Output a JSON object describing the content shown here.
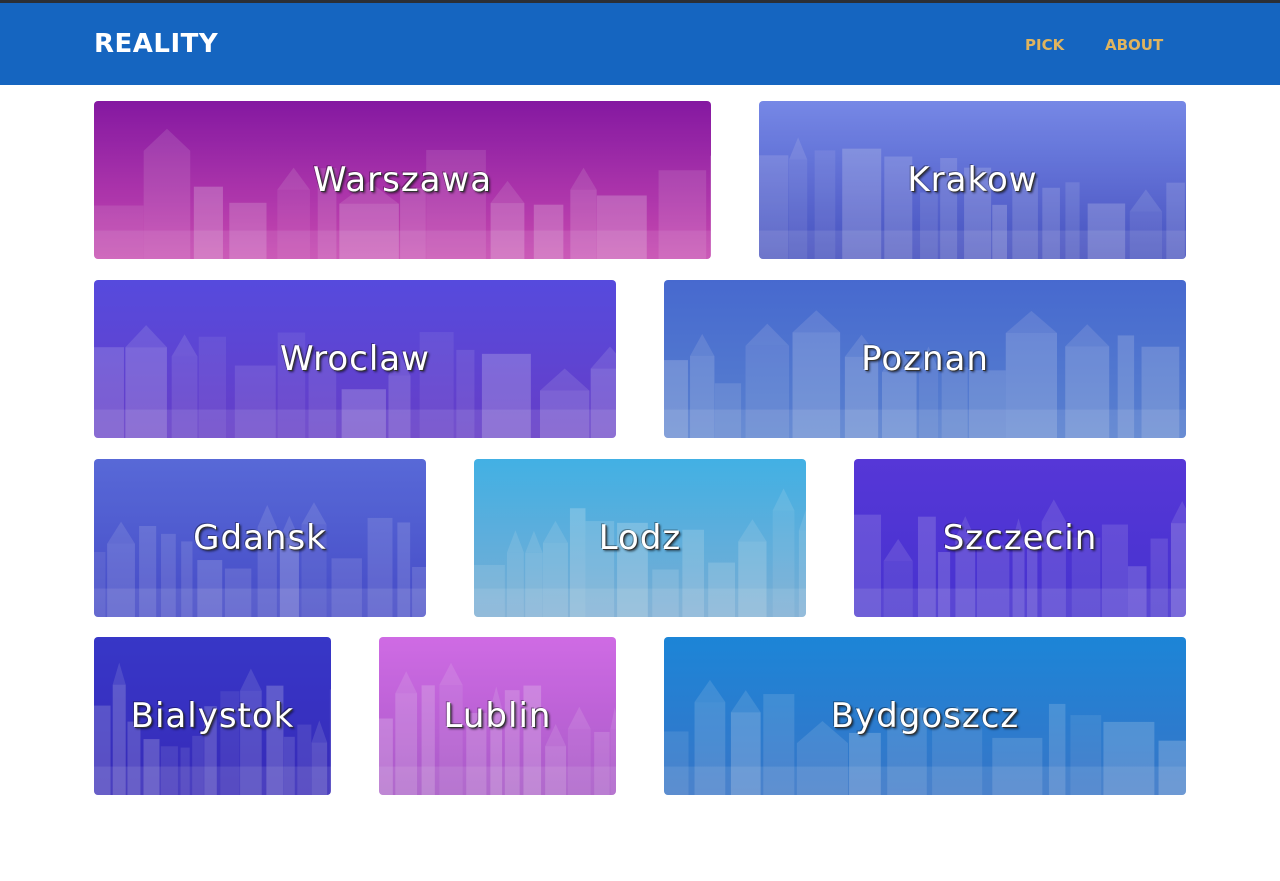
{
  "header": {
    "brand": "REALITY",
    "nav": [
      {
        "label": "PICK"
      },
      {
        "label": "ABOUT"
      }
    ],
    "background_color": "#1565c0",
    "link_color": "#e0b45e"
  },
  "cities": [
    {
      "name": "Warszawa",
      "tint_top": "#8a1aa8",
      "tint_bottom": "#d04cb8"
    },
    {
      "name": "Krakow",
      "tint_top": "#7b8ef0",
      "tint_bottom": "#4a55c8"
    },
    {
      "name": "Wroclaw",
      "tint_top": "#5a4ee6",
      "tint_bottom": "#6a40d0"
    },
    {
      "name": "Poznan",
      "tint_top": "#4a6ed8",
      "tint_bottom": "#5d86d8"
    },
    {
      "name": "Gdansk",
      "tint_top": "#5c6ee0",
      "tint_bottom": "#4a4fd0"
    },
    {
      "name": "Lodz",
      "tint_top": "#45b8ee",
      "tint_bottom": "#7fb4dc"
    },
    {
      "name": "Szczecin",
      "tint_top": "#5a3ae0",
      "tint_bottom": "#4a35d8"
    },
    {
      "name": "Bialystok",
      "tint_top": "#3a3ad0",
      "tint_bottom": "#3a2cc0"
    },
    {
      "name": "Lublin",
      "tint_top": "#d870ee",
      "tint_bottom": "#b05ed0"
    },
    {
      "name": "Bydgoszcz",
      "tint_top": "#1e8be0",
      "tint_bottom": "#3a7ad0"
    }
  ]
}
